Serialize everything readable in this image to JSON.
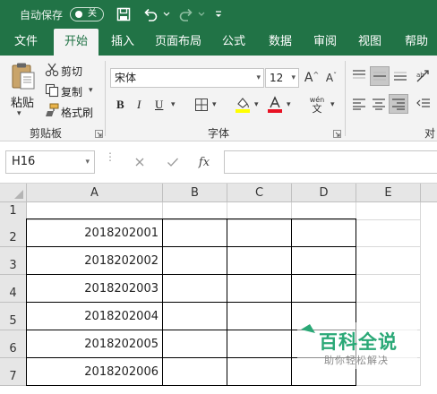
{
  "titlebar": {
    "autosave_label": "自动保存",
    "autosave_state": "关",
    "qa_icons": [
      "save-icon",
      "undo-icon",
      "redo-icon",
      "customize-icon"
    ]
  },
  "tabs": [
    {
      "label": "文件",
      "active": false
    },
    {
      "label": "开始",
      "active": true
    },
    {
      "label": "插入",
      "active": false
    },
    {
      "label": "页面布局",
      "active": false
    },
    {
      "label": "公式",
      "active": false
    },
    {
      "label": "数据",
      "active": false
    },
    {
      "label": "审阅",
      "active": false
    },
    {
      "label": "视图",
      "active": false
    },
    {
      "label": "帮助",
      "active": false
    }
  ],
  "ribbon": {
    "clipboard": {
      "paste_label": "粘贴",
      "cut_label": "剪切",
      "copy_label": "复制",
      "format_painter_label": "格式刷",
      "group_label": "剪贴板"
    },
    "font": {
      "font_name": "宋体",
      "font_size": "12",
      "bold": "B",
      "italic": "I",
      "underline": "U",
      "grow": "A",
      "shrink": "A",
      "phonetic_top": "wén",
      "phonetic_bottom": "文",
      "group_label": "字体",
      "fill_color": "#ffff00",
      "font_color": "#e81123"
    },
    "alignment": {
      "group_label_partial": "对"
    }
  },
  "formula_bar": {
    "name_box": "H16",
    "fx_label": "fx",
    "formula_value": ""
  },
  "sheet": {
    "columns": [
      "A",
      "B",
      "C",
      "D",
      "E"
    ],
    "rows": [
      {
        "num": "1",
        "A": ""
      },
      {
        "num": "2",
        "A": "2018202001"
      },
      {
        "num": "3",
        "A": "2018202002"
      },
      {
        "num": "4",
        "A": "2018202003"
      },
      {
        "num": "5",
        "A": "2018202004"
      },
      {
        "num": "6",
        "A": "2018202005"
      },
      {
        "num": "7",
        "A": "2018202006"
      }
    ]
  },
  "watermark": {
    "title": "百科全说",
    "subtitle": "助你轻松解决"
  },
  "colors": {
    "excel_green": "#217346",
    "ribbon_bg": "#f3f3f3",
    "header_bg": "#e6e6e6",
    "watermark_green": "#2aa876"
  }
}
